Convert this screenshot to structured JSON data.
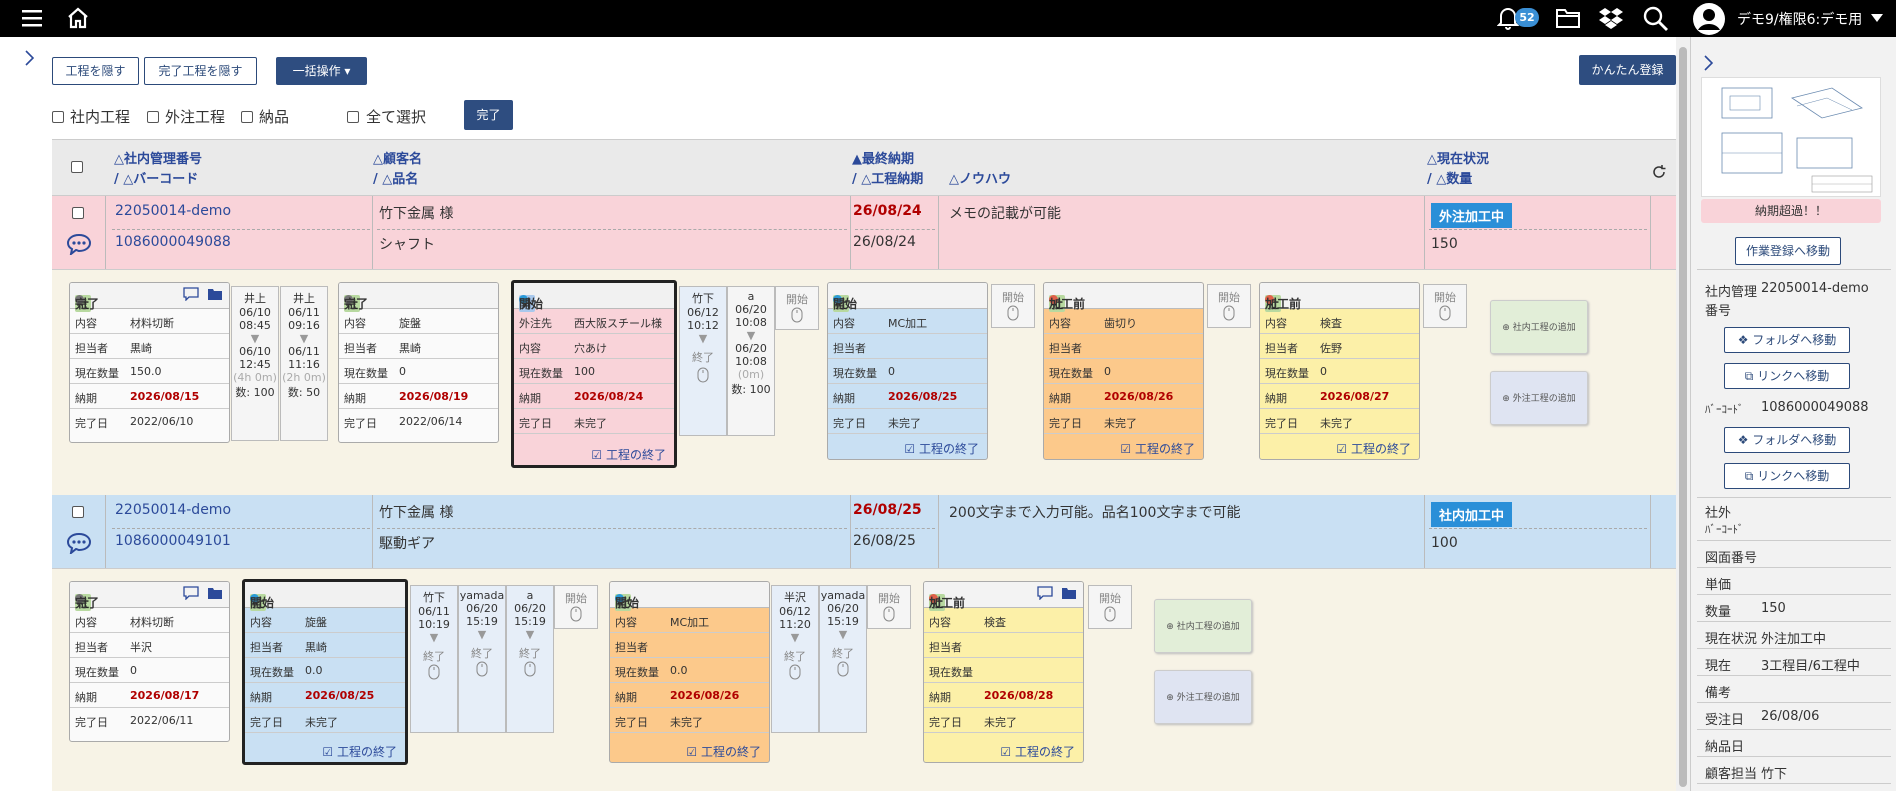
{
  "topbar": {
    "notif_count": "52",
    "user": "デモ9/権限6:デモ用"
  },
  "toolbar": {
    "hide_process": "工程を隠す",
    "hide_done": "完了工程を隠す",
    "bulk": "一括操作",
    "quick_register": "かんたん登録",
    "filter_internal": "社内工程",
    "filter_external": "外注工程",
    "filter_delivery": "納品",
    "select_all": "全て選択",
    "done": "完了"
  },
  "header": {
    "col1a": "△社内管理番号",
    "col1b": "/ △バーコード",
    "col2a": "△顧客名",
    "col2b": "/ △品名",
    "col3a": "▲最終納期",
    "col3b": "/ △工程納期",
    "col4": "△ノウハウ",
    "col5a": "△現在状況",
    "col5b": "/ △数量"
  },
  "orders": [
    {
      "id": "22050014-demo",
      "barcode": "1086000049088",
      "customer": "竹下金属 様",
      "product": "シャフト",
      "final_due": "26/08/24",
      "proc_due": "26/08/24",
      "knowhow": "メモの記載が可能",
      "status": "外注加工中",
      "qty": "150"
    },
    {
      "id": "22050014-demo",
      "barcode": "1086000049101",
      "customer": "竹下金属 様",
      "product": "駆動ギア",
      "final_due": "26/08/25",
      "proc_due": "26/08/25",
      "knowhow": "200文字まで入力可能。品名100文字まで可能",
      "status": "社内加工中",
      "qty": "100"
    }
  ],
  "labels": {
    "content": "内容",
    "person": "担当者",
    "qty": "現在数量",
    "due": "納期",
    "done_date": "完了日",
    "vendor": "外注先",
    "finish": "工程の終了",
    "start": "開始",
    "end": "終了",
    "add_internal": "社内工程の追加",
    "add_external": "外注工程の追加",
    "not_done": "未完了",
    "sha": "社",
    "gai": "外",
    "arrow": "▼"
  },
  "stage1": {
    "p1": {
      "no": "1",
      "status": "完了",
      "content": "材料切断",
      "person": "黒崎",
      "qty": "150.0",
      "due": "2026/08/15",
      "done": "2022/06/10"
    },
    "t1a": {
      "name": "井上",
      "d1": "06/10",
      "t1": "08:45",
      "d2": "06/10",
      "t2": "12:45",
      "dur": "(4h 0m)",
      "qty": "数: 100"
    },
    "t1b": {
      "name": "井上",
      "d1": "06/11",
      "t1": "09:16",
      "d2": "06/11",
      "t2": "11:16",
      "dur": "(2h 0m)",
      "qty": "数: 50"
    },
    "p2": {
      "no": "2",
      "status": "完了",
      "content": "旋盤",
      "person": "黒崎",
      "qty": "0",
      "due": "2026/08/19",
      "done": "2022/06/14"
    },
    "p3": {
      "no": "3",
      "status": "開始",
      "vendor": "西大阪スチール様",
      "content": "穴あけ",
      "qty": "100",
      "due": "2026/08/24",
      "done": "未完了"
    },
    "t3a": {
      "name": "竹下",
      "d1": "06/12",
      "t1": "10:12"
    },
    "t3b": {
      "name": "a",
      "d1": "06/20",
      "t1": "10:08",
      "d2": "06/20",
      "t2": "10:08",
      "dur": "(0m)",
      "qty": "数: 100"
    },
    "p4": {
      "no": "4",
      "status": "開始",
      "content": "MC加工",
      "person": "",
      "qty": "0",
      "due": "2026/08/25",
      "done": "未完了"
    },
    "p5": {
      "no": "5",
      "status": "加工前",
      "content": "歯切り",
      "person": "",
      "qty": "0",
      "due": "2026/08/26",
      "done": "未完了"
    },
    "p6": {
      "no": "6",
      "status": "加工前",
      "content": "検査",
      "person": "佐野",
      "qty": "0",
      "due": "2026/08/27",
      "done": "未完了"
    }
  },
  "stage2": {
    "p1": {
      "no": "1",
      "status": "完了",
      "content": "材料切断",
      "person": "半沢",
      "qty": "0",
      "due": "2026/08/17",
      "done": "2022/06/11"
    },
    "p2": {
      "no": "2",
      "status": "開始",
      "content": "旋盤",
      "person": "黒崎",
      "qty": "0.0",
      "due": "2026/08/25",
      "done": "未完了"
    },
    "t2a": {
      "name": "竹下",
      "d1": "06/11",
      "t1": "10:19"
    },
    "t2b": {
      "name": "yamada",
      "d1": "06/20",
      "t1": "15:19"
    },
    "t2c": {
      "name": "a",
      "d1": "06/20",
      "t1": "15:19"
    },
    "p3": {
      "no": "3",
      "status": "開始",
      "content": "MC加工",
      "person": "",
      "qty": "0.0",
      "due": "2026/08/26",
      "done": "未完了"
    },
    "t3a": {
      "name": "半沢",
      "d1": "06/12",
      "t1": "11:20"
    },
    "t3b": {
      "name": "yamada",
      "d1": "06/20",
      "t1": "15:19"
    },
    "p4": {
      "no": "4",
      "status": "加工前",
      "content": "検査",
      "person": "",
      "qty": "",
      "due": "2026/08/28",
      "done": "未完了"
    }
  },
  "sidebar": {
    "overdue": "納期超過！！",
    "work_reg": "作業登録へ移動",
    "folder": "フォルダへ移動",
    "link": "リンクへ移動",
    "mgmt_label": "社内管理",
    "mgmt_label2": "番号",
    "mgmt_value": "22050014-demo",
    "barcode_label": "ﾊﾞｰｺｰﾄﾞ",
    "barcode_value": "1086000049088",
    "ext_label": "社外",
    "ext_label2": "ﾊﾞｰｺｰﾄﾞ",
    "drawing_no": "図面番号",
    "unit_price": "単価",
    "qty_label": "数量",
    "qty_value": "150",
    "status_label": "現在状況",
    "status_value": "外注加工中",
    "current_label": "現在",
    "current_value": "3工程目/6工程中",
    "note_label": "備考",
    "order_date_label": "受注日",
    "order_date_value": "26/08/06",
    "delivery_label": "納品日",
    "cust_person_label": "顧客担当",
    "cust_person_value": "竹下"
  }
}
